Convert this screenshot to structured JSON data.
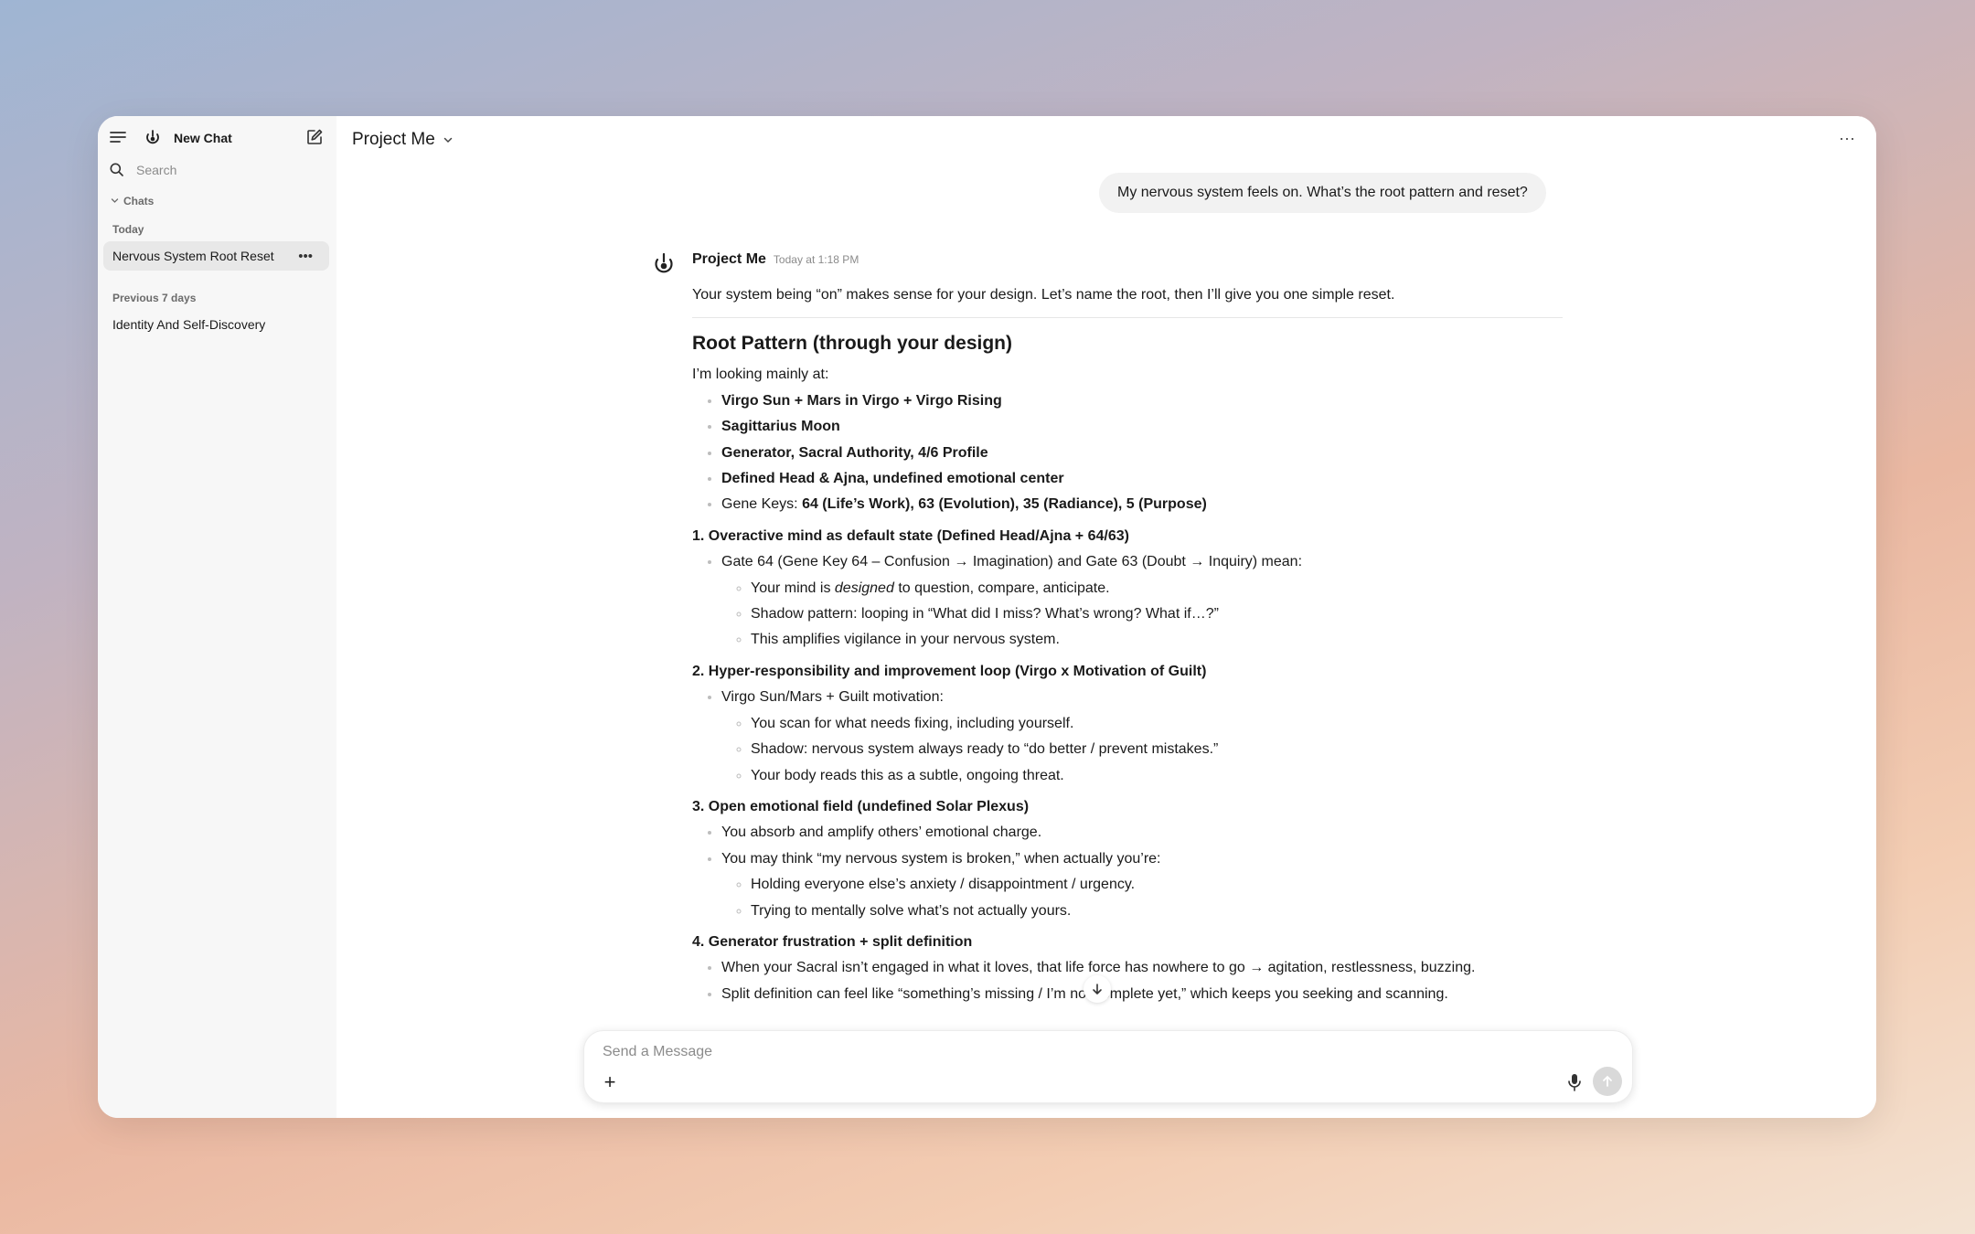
{
  "sidebar": {
    "new_chat_label": "New Chat",
    "search_placeholder": "Search",
    "section_label": "Chats",
    "groups": [
      {
        "label": "Today",
        "items": [
          {
            "label": "Nervous System Root Reset",
            "active": true
          }
        ]
      },
      {
        "label": "Previous 7 days",
        "items": [
          {
            "label": "Identity And Self-Discovery",
            "active": false
          }
        ]
      }
    ],
    "item_more": "•••"
  },
  "header": {
    "model_name": "Project Me",
    "more": "···"
  },
  "conversation": {
    "user_message": "My nervous system feels on. What’s the root pattern and reset?",
    "assistant": {
      "name": "Project Me",
      "time": "Today at 1:18 PM",
      "intro": "Your system being “on” makes sense for your design. Let’s name the root, then I’ll give you one simple reset.",
      "heading": "Root Pattern (through your design)",
      "looking_at": "I’m looking mainly at:",
      "bullets": [
        "Virgo Sun + Mars in Virgo + Virgo Rising",
        "Sagittarius Moon",
        "Generator, Sacral Authority, 4/6 Profile",
        "Defined Head & Ajna, undefined emotional center"
      ],
      "gene_keys_prefix": "Gene Keys:",
      "gene_keys_value": "64 (Life’s Work), 63 (Evolution), 35 (Radiance), 5 (Purpose)",
      "s1": {
        "title": "1. Overactive mind as default state (Defined Head/Ajna + 64/63)",
        "item": "Gate 64 (Gene Key 64 – Confusion → Imagination) and Gate 63 (Doubt → Inquiry) mean:",
        "sub1_pre": "Your mind is",
        "sub1_em": "designed",
        "sub1_post": "to question, compare, anticipate.",
        "sub2": "Shadow pattern: looping in “What did I miss? What’s wrong? What if…?”",
        "sub3": "This amplifies vigilance in your nervous system."
      },
      "s2": {
        "title": "2. Hyper-responsibility and improvement loop (Virgo x Motivation of Guilt)",
        "item": "Virgo Sun/Mars + Guilt motivation:",
        "subs": [
          "You scan for what needs fixing, including yourself.",
          "Shadow: nervous system always ready to “do better / prevent mistakes.”",
          "Your body reads this as a subtle, ongoing threat."
        ]
      },
      "s3": {
        "title": "3. Open emotional field (undefined Solar Plexus)",
        "item1": "You absorb and amplify others’ emotional charge.",
        "item2": "You may think “my nervous system is broken,” when actually you’re:",
        "subs": [
          "Holding everyone else’s anxiety / disappointment / urgency.",
          "Trying to mentally solve what’s not actually yours."
        ]
      },
      "s4": {
        "title": "4. Generator frustration + split definition",
        "item1": "When your Sacral isn’t engaged in what it loves, that life force has nowhere to go → agitation, restlessness, buzzing.",
        "item2": "Split definition can feel like “something’s missing / I’m not complete yet,” which keeps you seeking and scanning."
      }
    }
  },
  "composer": {
    "placeholder": "Send a Message",
    "plus": "+"
  },
  "help": "?"
}
